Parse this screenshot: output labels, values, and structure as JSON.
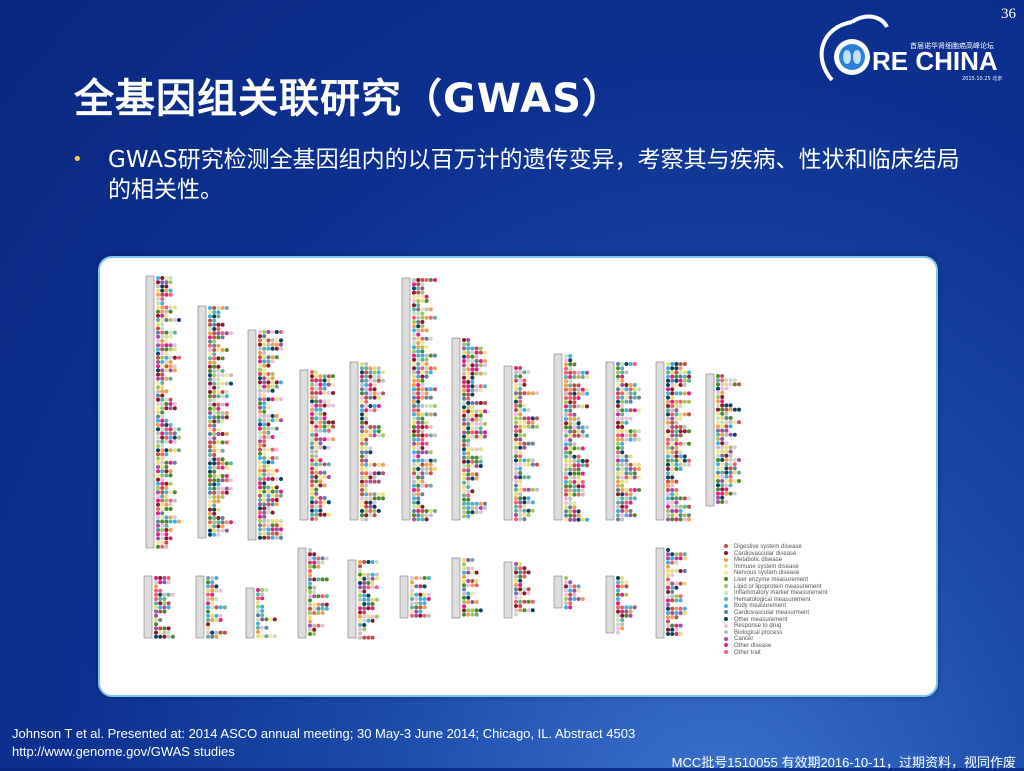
{
  "slide_number": "36",
  "logo": {
    "name": "CORE CHINA",
    "subtitle": "首届诺华肾细胞癌高峰论坛",
    "date": "2015.10.25 北京"
  },
  "title": "全基因组关联研究（GWAS）",
  "bullet": "GWAS研究检测全基因组内的以百万计的遗传变异，考察其与疾病、性状和临床结局的相关性。",
  "figure": {
    "legend": [
      {
        "label": "Digestive system disease",
        "color": "#c0504d"
      },
      {
        "label": "Cardiovascular disease",
        "color": "#8b1a2a"
      },
      {
        "label": "Metabolic disease",
        "color": "#f0a050"
      },
      {
        "label": "Immune system disease",
        "color": "#e8e070"
      },
      {
        "label": "Nervous system disease",
        "color": "#f5e6a0"
      },
      {
        "label": "Liver enzyme measurement",
        "color": "#4a8a2a"
      },
      {
        "label": "Lipid or lipoprotein measurement",
        "color": "#a0c860"
      },
      {
        "label": "Inflammatory marker measurement",
        "color": "#c8e0c0"
      },
      {
        "label": "Hematological measurement",
        "color": "#60b0a0"
      },
      {
        "label": "Body measurement",
        "color": "#40b0e0"
      },
      {
        "label": "Cardiovascular measurment",
        "color": "#6080a0"
      },
      {
        "label": "Other measurement",
        "color": "#0a4060"
      },
      {
        "label": "Response to drug",
        "color": "#e8c0e0"
      },
      {
        "label": "Biological process",
        "color": "#c0c0c0"
      },
      {
        "label": "Cancer",
        "color": "#a050a0"
      },
      {
        "label": "Other disease",
        "color": "#e0208a"
      },
      {
        "label": "Other trait",
        "color": "#f06070"
      }
    ]
  },
  "references": [
    "Johnson T et al. Presented at: 2014 ASCO annual meeting; 30 May-3 June 2014; Chicago, IL. Abstract 4503",
    "http://www.genome.gov/GWAS  studies"
  ],
  "approval": "MCC批号1510055 有效期2016-10-11，过期资料，视同作废"
}
